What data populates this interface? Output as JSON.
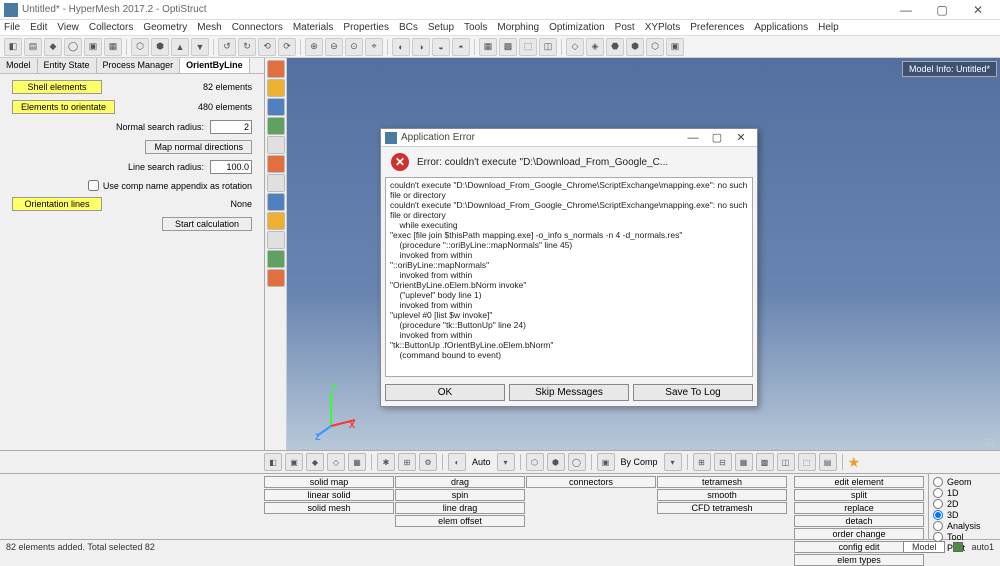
{
  "window": {
    "title": "Untitled* - HyperMesh 2017.2 - OptiStruct",
    "controls": {
      "min": "—",
      "max": "▢",
      "close": "✕"
    }
  },
  "menu": [
    "File",
    "Edit",
    "View",
    "Collectors",
    "Geometry",
    "Mesh",
    "Connectors",
    "Materials",
    "Properties",
    "BCs",
    "Setup",
    "Tools",
    "Morphing",
    "Optimization",
    "Post",
    "XYPlots",
    "Preferences",
    "Applications",
    "Help"
  ],
  "tabs": [
    "Model",
    "Entity State",
    "Process Manager",
    "OrientByLine"
  ],
  "panel": {
    "shell_btn": "Shell elements",
    "shell_val": "82 elements",
    "orient_btn": "Elements to orientate",
    "orient_val": "480 elements",
    "nsr_lbl": "Normal search radius:",
    "nsr_val": "2",
    "map_btn": "Map normal directions",
    "lsr_lbl": "Line search radius:",
    "lsr_val": "100.0",
    "chk_lbl": "Use comp name appendix as rotation",
    "olines_btn": "Orientation lines",
    "olines_val": "None",
    "start_btn": "Start calculation"
  },
  "viewport": {
    "model_info": "Model Info: Untitled*",
    "axes": {
      "x": "X",
      "y": "Y",
      "z": "Z"
    },
    "note": "◱"
  },
  "dialog": {
    "title": "Application Error",
    "controls": {
      "min": "—",
      "max": "▢",
      "close": "✕"
    },
    "msg": "Error: couldn't execute \"D:\\Download_From_Google_C...",
    "body": "couldn't execute \"D:\\Download_From_Google_Chrome\\ScriptExchange\\mapping.exe\": no such file or directory\ncouldn't execute \"D:\\Download_From_Google_Chrome\\ScriptExchange\\mapping.exe\": no such file or directory\n    while executing\n\"exec [file join $thisPath mapping.exe] -o_info s_normals -n 4 -d_normals.res\"\n    (procedure \"::oriByLine::mapNormals\" line 45)\n    invoked from within\n\"::oriByLine::mapNormals\"\n    invoked from within\n\"OrientByLine.oElem.bNorm invoke\"\n    (\"uplevel\" body line 1)\n    invoked from within\n\"uplevel #0 [list $w invoke]\"\n    (procedure \"tk::ButtonUp\" line 24)\n    invoked from within\n\"tk::ButtonUp .fOrientByLine.oElem.bNorm\"\n    (command bound to event)",
    "buttons": {
      "ok": "OK",
      "skip": "Skip Messages",
      "save": "Save To Log"
    }
  },
  "toolbar2": {
    "auto": "Auto",
    "bycomp": "By Comp"
  },
  "btable": {
    "c0": [
      "solid map",
      "linear solid",
      "solid mesh"
    ],
    "c1": [
      "drag",
      "spin",
      "line drag",
      "elem offset"
    ],
    "c2": [
      "connectors"
    ],
    "c3": [
      "tetramesh",
      "smooth",
      "CFD tetramesh"
    ],
    "c4": [
      "edit element",
      "split",
      "replace",
      "detach",
      "order change",
      "config edit",
      "elem types"
    ]
  },
  "radios": [
    "Geom",
    "1D",
    "2D",
    "3D",
    "Analysis",
    "Tool",
    "Post"
  ],
  "status": {
    "msg": "82 elements added. Total selected 82",
    "model": "Model",
    "auto": "auto1"
  }
}
